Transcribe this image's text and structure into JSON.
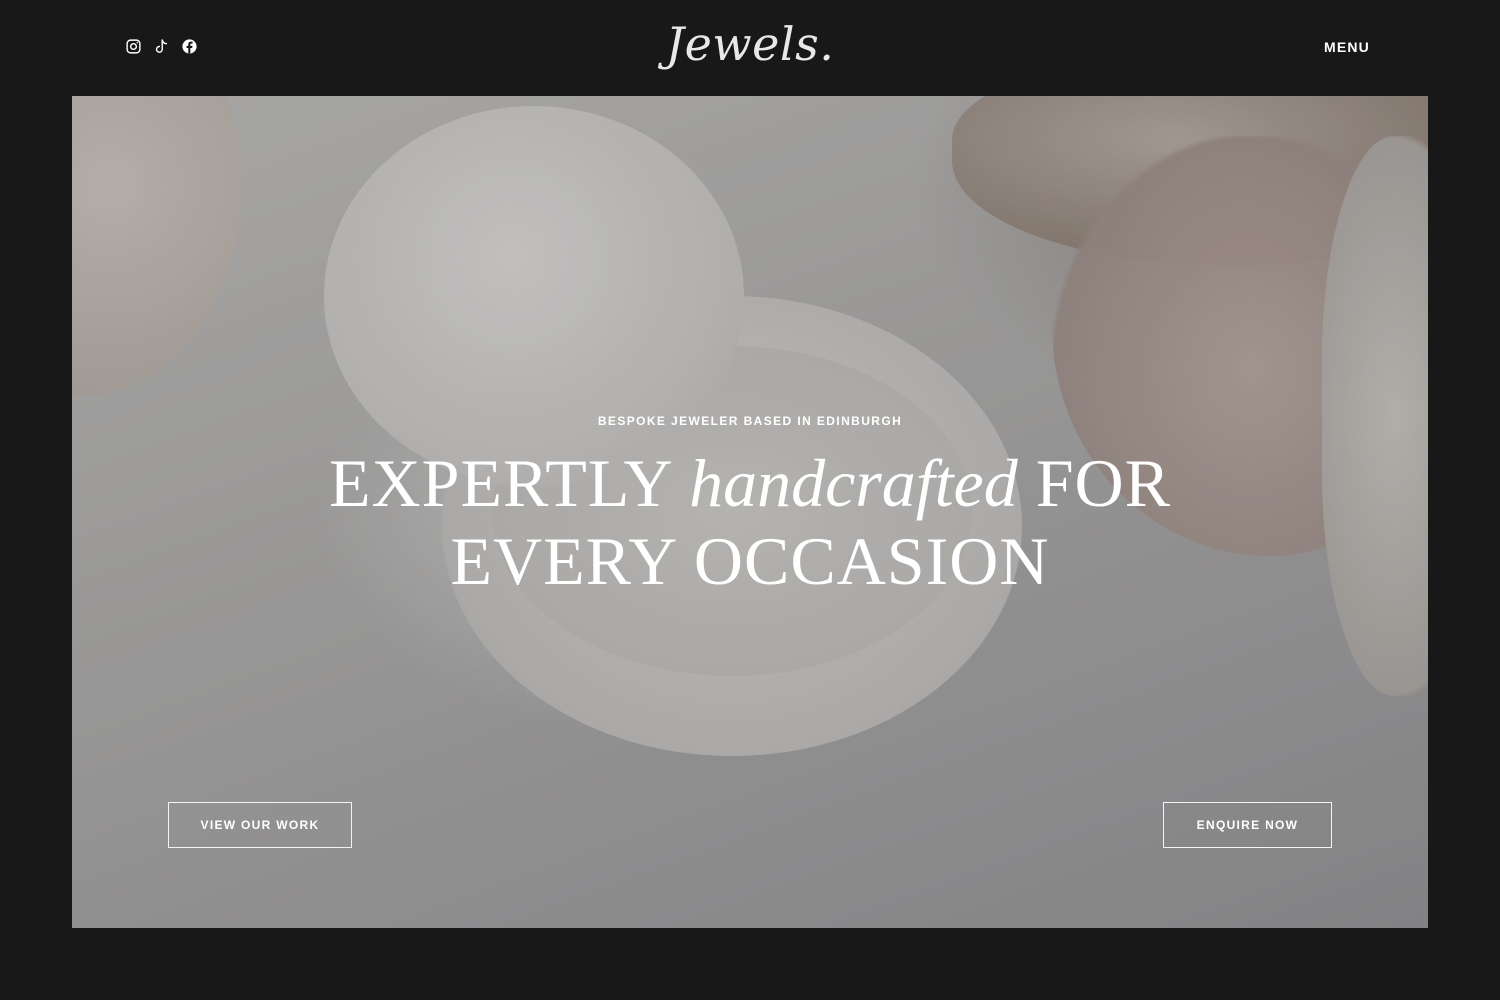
{
  "header": {
    "logo": "Jewels.",
    "menu_label": "MENU",
    "social": [
      {
        "icon": "instagram-icon"
      },
      {
        "icon": "tiktok-icon"
      },
      {
        "icon": "facebook-icon"
      }
    ]
  },
  "hero": {
    "eyebrow": "BESPOKE JEWELER BASED IN EDINBURGH",
    "headline_part1": "EXPERTLY ",
    "headline_emphasis": "handcrafted",
    "headline_part2": " FOR",
    "headline_line2": "EVERY OCCASION",
    "primary_button": "VIEW OUR WORK",
    "secondary_button": "ENQUIRE NOW"
  },
  "colors": {
    "background": "#181818",
    "text": "#ffffff"
  }
}
